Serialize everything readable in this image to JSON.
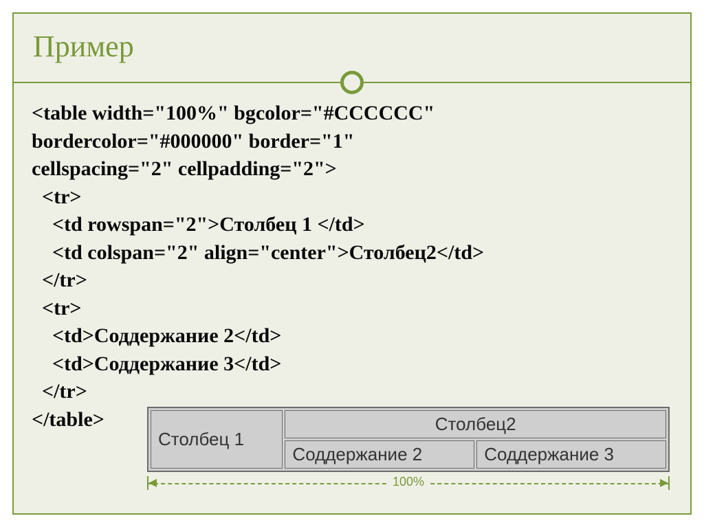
{
  "title": "Пример",
  "code": {
    "l1": "<table width=\"100%\" bgcolor=\"#CCCCCC\"",
    "l2": "bordercolor=\"#000000\" border=\"1\"",
    "l3": "cellspacing=\"2\" cellpadding=\"2\">",
    "l4": "  <tr>",
    "l5": "    <td rowspan=\"2\">Столбец 1 </td>",
    "l6": "    <td colspan=\"2\" align=\"center\">Столбец2</td>",
    "l7": "  </tr>",
    "l8": "  <tr>",
    "l9": "    <td>Соддержание 2</td>",
    "l10": "    <td>Соддержание 3</td>",
    "l11": "  </tr>",
    "l12": "</table>"
  },
  "render": {
    "col1": "Столбец 1",
    "col2_header": "Столбец2",
    "cell2": "Соддержание 2",
    "cell3": "Соддержание 3"
  },
  "dimension_label": "100%"
}
